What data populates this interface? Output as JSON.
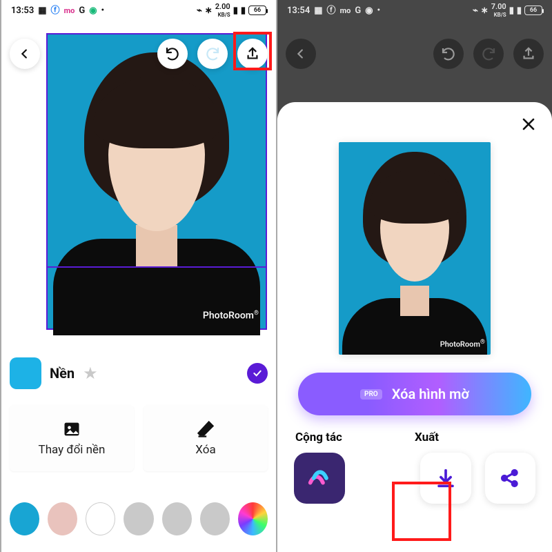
{
  "status": {
    "left": {
      "time": "13:53",
      "net": "2.00",
      "unit": "KB/S",
      "bat": "66"
    },
    "right": {
      "time": "13:54",
      "net": "7.00",
      "unit": "KB/S",
      "bat": "66"
    }
  },
  "editor": {
    "watermark": "PhotoRoom",
    "bg_label": "Nền",
    "action_change_bg": "Thay đổi nền",
    "action_erase": "Xóa",
    "palette": [
      "#18a5d3",
      "#e9c3bd",
      "#ffffff",
      "#c9c9c9",
      "#c9c9c9",
      "#c9c9c9",
      "rainbow"
    ],
    "selected_bg": "#1db2e6"
  },
  "sheet": {
    "pro_chip": "PRO",
    "pro_label": "Xóa hình mờ",
    "section_collab": "Cộng tác",
    "section_export": "Xuất",
    "watermark": "PhotoRoom"
  }
}
